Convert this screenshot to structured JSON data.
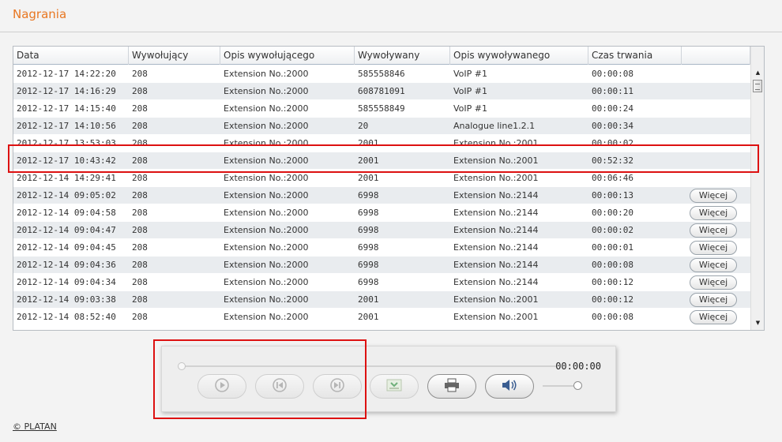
{
  "page": {
    "title": "Nagrania"
  },
  "table": {
    "columns": [
      "Data",
      "Wywołujący",
      "Opis wywołującego",
      "Wywoływany",
      "Opis wywoływanego",
      "Czas trwania",
      ""
    ],
    "more_label": "Więcej",
    "rows": [
      {
        "date": "2012-12-17 14:22:20",
        "caller": "208",
        "caller_desc": "Extension No.:2000",
        "callee": "585558846",
        "callee_desc": "VoIP #1",
        "duration": "00:00:08",
        "more": false
      },
      {
        "date": "2012-12-17 14:16:29",
        "caller": "208",
        "caller_desc": "Extension No.:2000",
        "callee": "608781091",
        "callee_desc": "VoIP #1",
        "duration": "00:00:11",
        "more": false
      },
      {
        "date": "2012-12-17 14:15:40",
        "caller": "208",
        "caller_desc": "Extension No.:2000",
        "callee": "585558849",
        "callee_desc": "VoIP #1",
        "duration": "00:00:24",
        "more": false
      },
      {
        "date": "2012-12-17 14:10:56",
        "caller": "208",
        "caller_desc": "Extension No.:2000",
        "callee": "20",
        "callee_desc": "Analogue line1.2.1",
        "duration": "00:00:34",
        "more": false
      },
      {
        "date": "2012-12-17 13:53:03",
        "caller": "208",
        "caller_desc": "Extension No.:2000",
        "callee": "2001",
        "callee_desc": "Extension No.:2001",
        "duration": "00:00:02",
        "more": false
      },
      {
        "date": "2012-12-17 10:43:42",
        "caller": "208",
        "caller_desc": "Extension No.:2000",
        "callee": "2001",
        "callee_desc": "Extension No.:2001",
        "duration": "00:52:32",
        "more": false
      },
      {
        "date": "2012-12-14 14:29:41",
        "caller": "208",
        "caller_desc": "Extension No.:2000",
        "callee": "2001",
        "callee_desc": "Extension No.:2001",
        "duration": "00:06:46",
        "more": false
      },
      {
        "date": "2012-12-14 09:05:02",
        "caller": "208",
        "caller_desc": "Extension No.:2000",
        "callee": "6998",
        "callee_desc": "Extension No.:2144",
        "duration": "00:00:13",
        "more": true
      },
      {
        "date": "2012-12-14 09:04:58",
        "caller": "208",
        "caller_desc": "Extension No.:2000",
        "callee": "6998",
        "callee_desc": "Extension No.:2144",
        "duration": "00:00:20",
        "more": true
      },
      {
        "date": "2012-12-14 09:04:47",
        "caller": "208",
        "caller_desc": "Extension No.:2000",
        "callee": "6998",
        "callee_desc": "Extension No.:2144",
        "duration": "00:00:02",
        "more": true
      },
      {
        "date": "2012-12-14 09:04:45",
        "caller": "208",
        "caller_desc": "Extension No.:2000",
        "callee": "6998",
        "callee_desc": "Extension No.:2144",
        "duration": "00:00:01",
        "more": true
      },
      {
        "date": "2012-12-14 09:04:36",
        "caller": "208",
        "caller_desc": "Extension No.:2000",
        "callee": "6998",
        "callee_desc": "Extension No.:2144",
        "duration": "00:00:08",
        "more": true
      },
      {
        "date": "2012-12-14 09:04:34",
        "caller": "208",
        "caller_desc": "Extension No.:2000",
        "callee": "6998",
        "callee_desc": "Extension No.:2144",
        "duration": "00:00:12",
        "more": true
      },
      {
        "date": "2012-12-14 09:03:38",
        "caller": "208",
        "caller_desc": "Extension No.:2000",
        "callee": "2001",
        "callee_desc": "Extension No.:2001",
        "duration": "00:00:12",
        "more": true
      },
      {
        "date": "2012-12-14 08:52:40",
        "caller": "208",
        "caller_desc": "Extension No.:2000",
        "callee": "2001",
        "callee_desc": "Extension No.:2001",
        "duration": "00:00:08",
        "more": true
      }
    ]
  },
  "player": {
    "time": "00:00:00",
    "seek_position": 0,
    "volume_level": 1.0,
    "icons": {
      "play": "play-icon",
      "prev": "skip-back-icon",
      "next": "skip-forward-icon",
      "download": "download-icon",
      "print": "printer-icon",
      "volume": "speaker-icon"
    }
  },
  "footer": {
    "copyright": "© PLATAN"
  },
  "colors": {
    "title": "#e87722",
    "highlight": "#dd1111"
  }
}
